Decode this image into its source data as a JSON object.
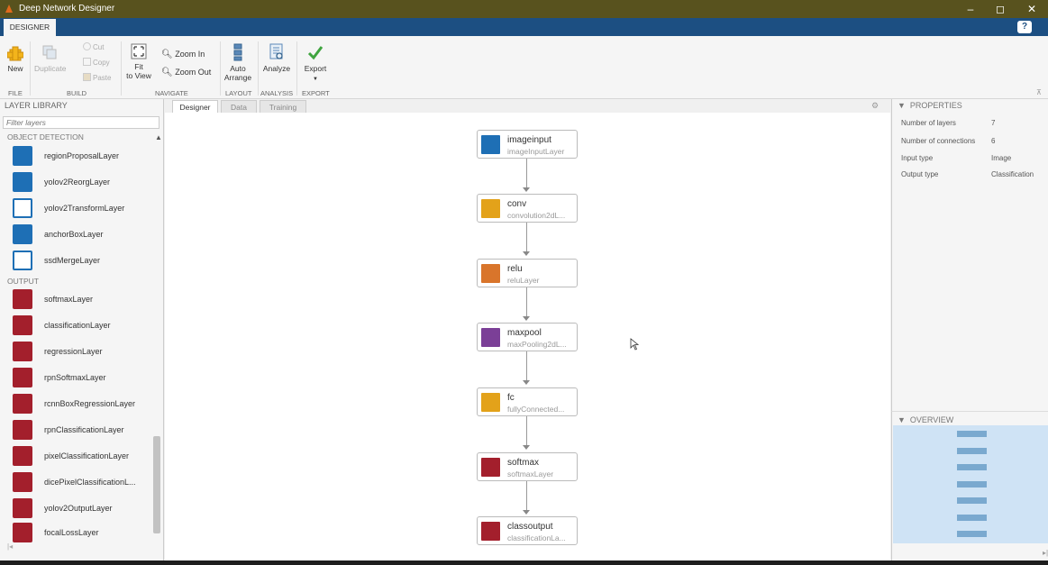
{
  "window": {
    "title": "Deep Network Designer"
  },
  "ribbon": {
    "tab": "DESIGNER",
    "help_icon": "?",
    "buttons": {
      "new": "New",
      "duplicate": "Duplicate",
      "cut": "Cut",
      "copy": "Copy",
      "paste": "Paste",
      "fit_line1": "Fit",
      "fit_line2": "to View",
      "zoom_in": "Zoom In",
      "zoom_out": "Zoom Out",
      "auto_line1": "Auto",
      "auto_line2": "Arrange",
      "analyze": "Analyze",
      "export": "Export",
      "export_arrow": "▼"
    },
    "sections": {
      "file": "FILE",
      "build": "BUILD",
      "navigate": "NAVIGATE",
      "layout": "LAYOUT",
      "analysis": "ANALYSIS",
      "export": "EXPORT"
    }
  },
  "layer_library": {
    "title": "LAYER LIBRARY",
    "filter_placeholder": "Filter layers",
    "categories": {
      "object_detection": "OBJECT DETECTION",
      "output": "OUTPUT"
    },
    "object_detection_items": [
      {
        "label": "regionProposalLayer",
        "icon": "region-proposal-icon",
        "color": "#1e6fb5"
      },
      {
        "label": "yolov2ReorgLayer",
        "icon": "yolo-reorg-icon",
        "color": "#1e6fb5"
      },
      {
        "label": "yolov2TransformLayer",
        "icon": "yolo-transform-icon",
        "color": "#1e6fb5"
      },
      {
        "label": "anchorBoxLayer",
        "icon": "anchor-box-icon",
        "color": "#1e6fb5"
      },
      {
        "label": "ssdMergeLayer",
        "icon": "ssd-merge-icon",
        "color": "#1e6fb5"
      }
    ],
    "output_items": [
      {
        "label": "softmaxLayer",
        "icon": "softmax-icon",
        "color": "#a31f2c"
      },
      {
        "label": "classificationLayer",
        "icon": "classification-icon",
        "color": "#a31f2c"
      },
      {
        "label": "regressionLayer",
        "icon": "regression-icon",
        "color": "#a31f2c"
      },
      {
        "label": "rpnSoftmaxLayer",
        "icon": "rpn-softmax-icon",
        "color": "#a31f2c"
      },
      {
        "label": "rcnnBoxRegressionLayer",
        "icon": "rcnn-box-icon",
        "color": "#a31f2c"
      },
      {
        "label": "rpnClassificationLayer",
        "icon": "rpn-classification-icon",
        "color": "#a31f2c"
      },
      {
        "label": "pixelClassificationLayer",
        "icon": "pixel-classification-icon",
        "color": "#a31f2c"
      },
      {
        "label": "dicePixelClassificationL...",
        "icon": "dice-pixel-icon",
        "color": "#a31f2c"
      },
      {
        "label": "yolov2OutputLayer",
        "icon": "yolo-output-icon",
        "color": "#a31f2c"
      },
      {
        "label": "focalLossLayer",
        "icon": "focal-loss-icon",
        "color": "#a31f2c"
      }
    ]
  },
  "doc_tabs": [
    "Designer",
    "Data",
    "Training"
  ],
  "network": {
    "layers": [
      {
        "name": "imageinput",
        "type": "imageInputLayer",
        "icon": "image-input-icon",
        "color": "#1e6fb5"
      },
      {
        "name": "conv",
        "type": "convolution2dL...",
        "icon": "convolution-icon",
        "color": "#e3a21a"
      },
      {
        "name": "relu",
        "type": "reluLayer",
        "icon": "relu-icon",
        "color": "#d9752b"
      },
      {
        "name": "maxpool",
        "type": "maxPooling2dL...",
        "icon": "maxpool-icon",
        "color": "#7b3f97"
      },
      {
        "name": "fc",
        "type": "fullyConnected...",
        "icon": "fully-connected-icon",
        "color": "#e3a21a"
      },
      {
        "name": "softmax",
        "type": "softmaxLayer",
        "icon": "softmax-icon",
        "color": "#a31f2c"
      },
      {
        "name": "classoutput",
        "type": "classificationLa...",
        "icon": "classification-icon",
        "color": "#a31f2c"
      }
    ]
  },
  "properties": {
    "title": "PROPERTIES",
    "rows": [
      {
        "label": "Number of layers",
        "value": "7"
      },
      {
        "label": "Number of connections",
        "value": "6"
      },
      {
        "label": "Input type",
        "value": "Image"
      },
      {
        "label": "Output type",
        "value": "Classification"
      }
    ]
  },
  "overview": {
    "title": "OVERVIEW",
    "block_count": 7
  }
}
